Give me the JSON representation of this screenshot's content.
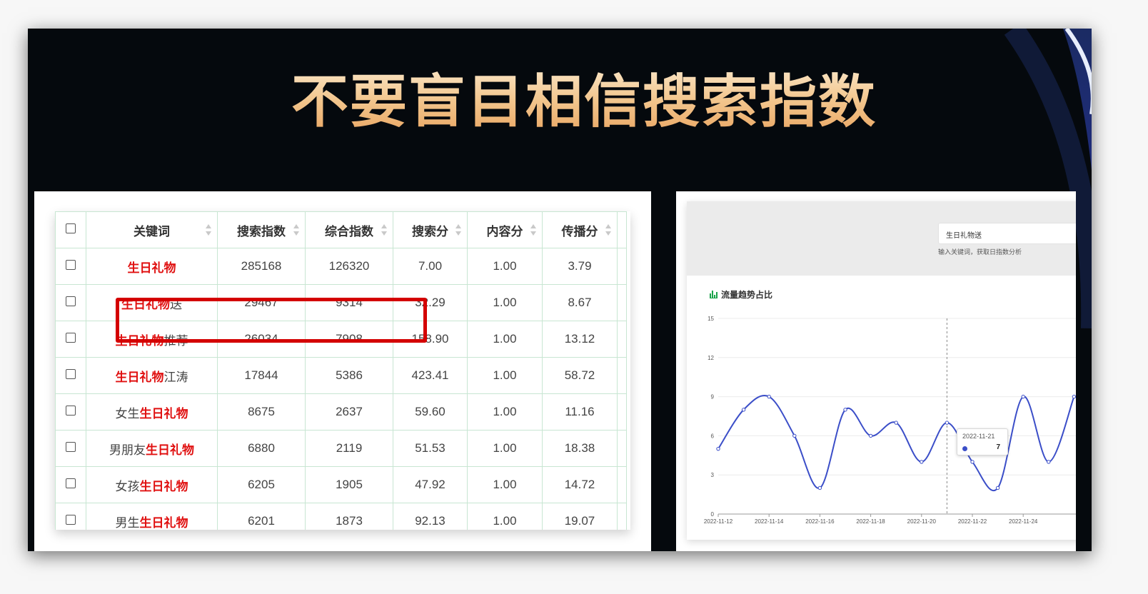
{
  "title": "不要盲目相信搜索指数",
  "table": {
    "headers": [
      "关键词",
      "搜索指数",
      "综合指数",
      "搜索分",
      "内容分",
      "传播分"
    ],
    "rows": [
      {
        "kw_pre": "",
        "kw_hl": "生日礼物",
        "kw_post": "",
        "search": "285168",
        "composite": "126320",
        "search_score": "7.00",
        "content_score": "1.00",
        "spread_score": "3.79"
      },
      {
        "kw_pre": "",
        "kw_hl": "生日礼物",
        "kw_post": "送",
        "search": "29467",
        "composite": "9314",
        "search_score": "32.29",
        "content_score": "1.00",
        "spread_score": "8.67"
      },
      {
        "kw_pre": "",
        "kw_hl": "生日礼物",
        "kw_post": "推荐",
        "search": "26034",
        "composite": "7908",
        "search_score": "158.90",
        "content_score": "1.00",
        "spread_score": "13.12"
      },
      {
        "kw_pre": "",
        "kw_hl": "生日礼物",
        "kw_post": "江涛",
        "search": "17844",
        "composite": "5386",
        "search_score": "423.41",
        "content_score": "1.00",
        "spread_score": "58.72"
      },
      {
        "kw_pre": "女生",
        "kw_hl": "生日礼物",
        "kw_post": "",
        "search": "8675",
        "composite": "2637",
        "search_score": "59.60",
        "content_score": "1.00",
        "spread_score": "11.16"
      },
      {
        "kw_pre": "男朋友",
        "kw_hl": "生日礼物",
        "kw_post": "",
        "search": "6880",
        "composite": "2119",
        "search_score": "51.53",
        "content_score": "1.00",
        "spread_score": "18.38"
      },
      {
        "kw_pre": "女孩",
        "kw_hl": "生日礼物",
        "kw_post": "",
        "search": "6205",
        "composite": "1905",
        "search_score": "47.92",
        "content_score": "1.00",
        "spread_score": "14.72"
      },
      {
        "kw_pre": "男生",
        "kw_hl": "生日礼物",
        "kw_post": "",
        "search": "6201",
        "composite": "1873",
        "search_score": "92.13",
        "content_score": "1.00",
        "spread_score": "19.07"
      }
    ]
  },
  "trend_panel": {
    "keyword_value": "生日礼物送",
    "hint": "输入关键词，获取日指数分析",
    "chart_title": "流量趋势占比",
    "tooltip": {
      "date": "2022-11-21",
      "value": "7"
    }
  },
  "chart_data": {
    "type": "line",
    "title": "流量趋势占比",
    "x": [
      "2022-11-12",
      "2022-11-13",
      "2022-11-14",
      "2022-11-15",
      "2022-11-16",
      "2022-11-17",
      "2022-11-18",
      "2022-11-19",
      "2022-11-20",
      "2022-11-21",
      "2022-11-22",
      "2022-11-23",
      "2022-11-24",
      "2022-11-25",
      "2022-11-26"
    ],
    "x_tick_labels": [
      "2022-11-12",
      "2022-11-14",
      "2022-11-16",
      "2022-11-18",
      "2022-11-20",
      "2022-11-22",
      "2022-11-24"
    ],
    "values": [
      5,
      8,
      9,
      6,
      2,
      8,
      6,
      7,
      4,
      7,
      4,
      2,
      9,
      4,
      9
    ],
    "yticks": [
      0,
      3,
      6,
      9,
      12,
      15
    ],
    "ylim": [
      0,
      15
    ],
    "grid": true,
    "series_color": "#3b4ec8"
  },
  "colors": {
    "highlight": "#e01010",
    "box": "#d40000",
    "line": "#3b4ec8",
    "border": "#c8e6d2"
  }
}
